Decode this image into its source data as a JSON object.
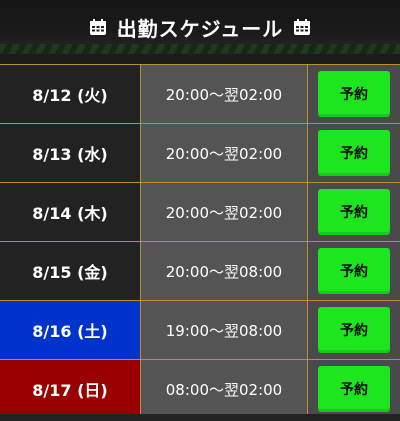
{
  "header": {
    "title": "出勤スケジュール",
    "icon_left": "calendar-icon",
    "icon_right": "calendar-icon"
  },
  "colors": {
    "reserve_button": "#1ee61e",
    "saturday_bg": "#0033cc",
    "sunday_bg": "#990000",
    "weekday_bg": "#222222",
    "time_bg": "#545454",
    "divider": "#b88e37"
  },
  "schedule": [
    {
      "date": "8/12 (火)",
      "time": "20:00～翌02:00",
      "button": "予約",
      "day_type": "weekday"
    },
    {
      "date": "8/13 (水)",
      "time": "20:00～翌02:00",
      "button": "予約",
      "day_type": "weekday"
    },
    {
      "date": "8/14 (木)",
      "time": "20:00～翌02:00",
      "button": "予約",
      "day_type": "weekday"
    },
    {
      "date": "8/15 (金)",
      "time": "20:00～翌08:00",
      "button": "予約",
      "day_type": "weekday"
    },
    {
      "date": "8/16 (土)",
      "time": "19:00～翌08:00",
      "button": "予約",
      "day_type": "saturday"
    },
    {
      "date": "8/17 (日)",
      "time": "08:00～翌02:00",
      "button": "予約",
      "day_type": "sunday"
    }
  ]
}
